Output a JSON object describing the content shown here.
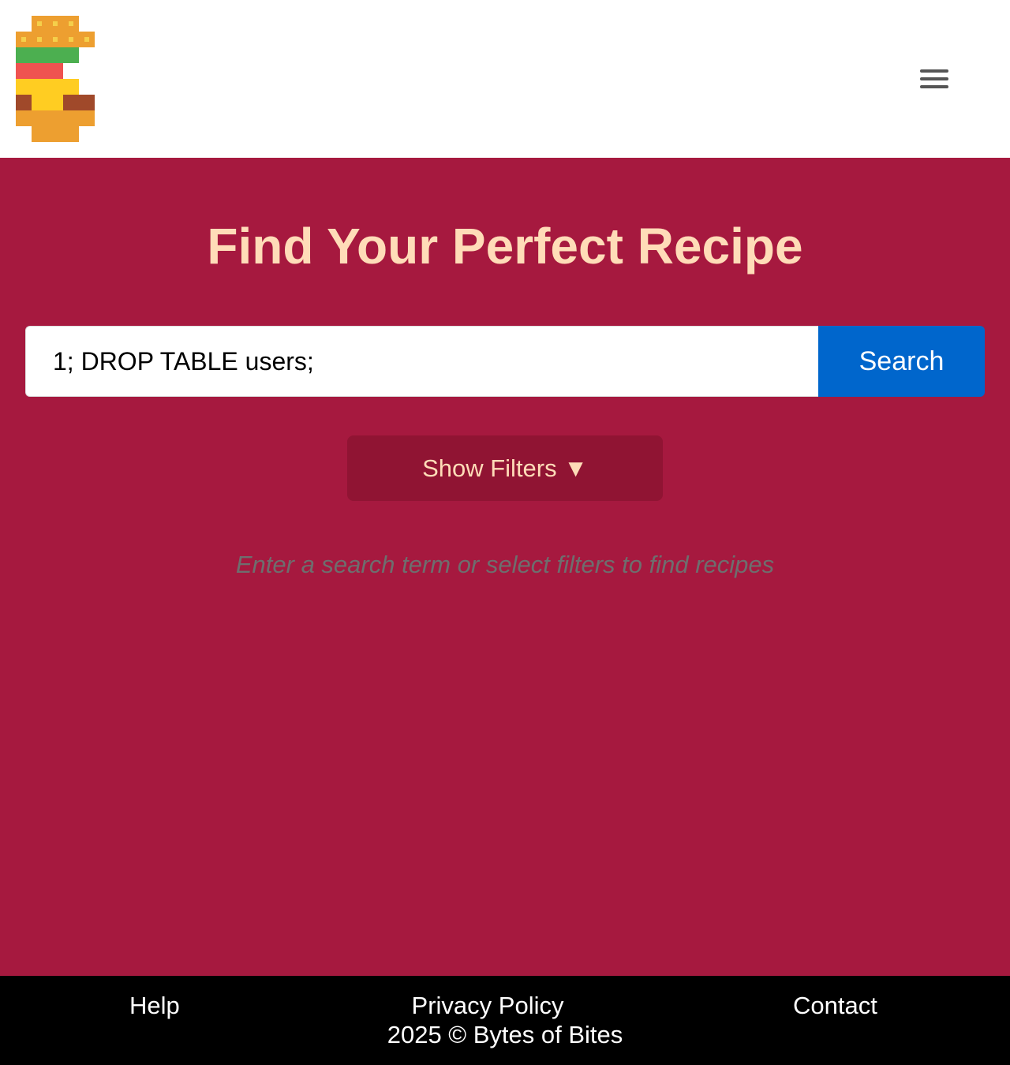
{
  "header": {
    "logo_name": "burger-logo",
    "menu_icon": "hamburger-menu-icon"
  },
  "main": {
    "title": "Find Your Perfect Recipe",
    "search": {
      "value": "1; DROP TABLE users;",
      "button_label": "Search"
    },
    "filters_label": "Show Filters ▼",
    "hint": "Enter a search term or select filters to find recipes"
  },
  "footer": {
    "links": {
      "help": "Help",
      "privacy": "Privacy Policy",
      "contact": "Contact"
    },
    "copyright": "2025 © Bytes of Bites"
  },
  "colors": {
    "page_background": "#a6193f",
    "title": "#ffdcb8",
    "search_button": "#0066cc",
    "filters_button": "#901433",
    "footer_background": "#000000"
  }
}
